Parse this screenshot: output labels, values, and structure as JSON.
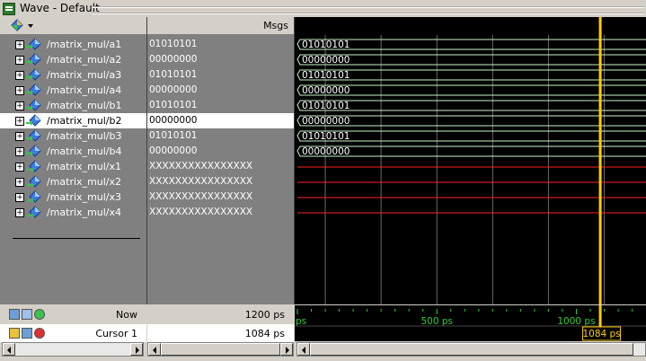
{
  "window": {
    "title": "Wave - Default"
  },
  "header": {
    "msgs_label": "Msgs"
  },
  "signals": [
    {
      "name": "/matrix_mul/a1",
      "value": "01010101",
      "kind": "input"
    },
    {
      "name": "/matrix_mul/a2",
      "value": "00000000",
      "kind": "input"
    },
    {
      "name": "/matrix_mul/a3",
      "value": "01010101",
      "kind": "input"
    },
    {
      "name": "/matrix_mul/a4",
      "value": "00000000",
      "kind": "input"
    },
    {
      "name": "/matrix_mul/b1",
      "value": "01010101",
      "kind": "input"
    },
    {
      "name": "/matrix_mul/b2",
      "value": "00000000",
      "kind": "input",
      "selected": true
    },
    {
      "name": "/matrix_mul/b3",
      "value": "01010101",
      "kind": "input"
    },
    {
      "name": "/matrix_mul/b4",
      "value": "00000000",
      "kind": "input"
    },
    {
      "name": "/matrix_mul/x1",
      "value": "XXXXXXXXXXXXXXXX",
      "kind": "output"
    },
    {
      "name": "/matrix_mul/x2",
      "value": "XXXXXXXXXXXXXXXX",
      "kind": "output"
    },
    {
      "name": "/matrix_mul/x3",
      "value": "XXXXXXXXXXXXXXXX",
      "kind": "output"
    },
    {
      "name": "/matrix_mul/x4",
      "value": "XXXXXXXXXXXXXXXX",
      "kind": "output"
    }
  ],
  "footer": {
    "now_label": "Now",
    "now_value": "1200 ps",
    "cursor_label": "Cursor 1",
    "cursor_value": "1084 ps"
  },
  "timeline": {
    "visible_range_ps": [
      0,
      1240
    ],
    "tick_labels": [
      {
        "time_ps": 0,
        "text": "ps"
      },
      {
        "time_ps": 500,
        "text": "500 ps"
      },
      {
        "time_ps": 1000,
        "text": "1000 ps"
      }
    ],
    "grid_ps": [
      100,
      300,
      500,
      700,
      900,
      1100
    ],
    "cursor_ps": 1084,
    "cursor_text": "1084 ps"
  },
  "colors": {
    "valid_wave": "#c8f5c8",
    "unknown_wave": "#ff2020",
    "cursor": "#ffcc00",
    "timeline_text": "#2fd12f"
  },
  "icons": {
    "window": "wave-window-icon",
    "signal": "signal-diamond-icon",
    "expand": "plus-expand-icon"
  }
}
